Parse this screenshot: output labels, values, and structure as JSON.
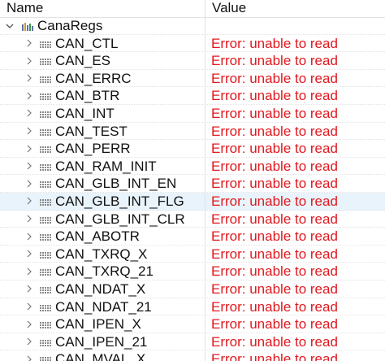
{
  "header": {
    "name_label": "Name",
    "value_label": "Value"
  },
  "root": {
    "label": "CanaRegs",
    "expanded": true,
    "icon": "register-group-icon"
  },
  "colors": {
    "error": "#e0191f",
    "selected_row": "#e9f3fb"
  },
  "rows": [
    {
      "name": "CAN_CTL",
      "value": "Error: unable to read"
    },
    {
      "name": "CAN_ES",
      "value": "Error: unable to read"
    },
    {
      "name": "CAN_ERRC",
      "value": "Error: unable to read"
    },
    {
      "name": "CAN_BTR",
      "value": "Error: unable to read"
    },
    {
      "name": "CAN_INT",
      "value": "Error: unable to read"
    },
    {
      "name": "CAN_TEST",
      "value": "Error: unable to read"
    },
    {
      "name": "CAN_PERR",
      "value": "Error: unable to read"
    },
    {
      "name": "CAN_RAM_INIT",
      "value": "Error: unable to read"
    },
    {
      "name": "CAN_GLB_INT_EN",
      "value": "Error: unable to read"
    },
    {
      "name": "CAN_GLB_INT_FLG",
      "value": "Error: unable to read",
      "selected": true
    },
    {
      "name": "CAN_GLB_INT_CLR",
      "value": "Error: unable to read"
    },
    {
      "name": "CAN_ABOTR",
      "value": "Error: unable to read"
    },
    {
      "name": "CAN_TXRQ_X",
      "value": "Error: unable to read"
    },
    {
      "name": "CAN_TXRQ_21",
      "value": "Error: unable to read"
    },
    {
      "name": "CAN_NDAT_X",
      "value": "Error: unable to read"
    },
    {
      "name": "CAN_NDAT_21",
      "value": "Error: unable to read"
    },
    {
      "name": "CAN_IPEN_X",
      "value": "Error: unable to read"
    },
    {
      "name": "CAN_IPEN_21",
      "value": "Error: unable to read"
    },
    {
      "name": "CAN_MVAL_X",
      "value": "Error: unable to read"
    }
  ]
}
